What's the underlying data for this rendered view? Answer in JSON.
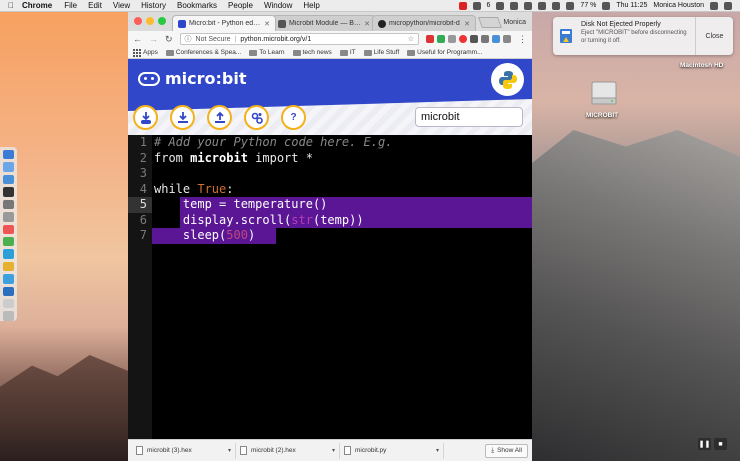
{
  "menubar": {
    "app": "Chrome",
    "items": [
      "File",
      "Edit",
      "View",
      "History",
      "Bookmarks",
      "People",
      "Window",
      "Help"
    ],
    "battery": "77 %",
    "clock": "Thu 11:25",
    "user": "Monica Houston",
    "badge_count": "6"
  },
  "tabs": [
    {
      "label": "Micro:bit - Python editor",
      "active": true,
      "favicon_color": "#2f47c8"
    },
    {
      "label": "Microbit Module — BBC m",
      "active": false,
      "favicon_color": "#555555"
    },
    {
      "label": "micropython/microbit-d",
      "active": false,
      "favicon_color": "#222222"
    }
  ],
  "profile": "Monica",
  "toolbar": {
    "security": "Not Secure",
    "url": "python.microbit.org/v/1"
  },
  "bookmarks": {
    "apps": "Apps",
    "items": [
      "Conferences & Spea...",
      "To Learn",
      "tech news",
      "IT",
      "Life Stuff",
      "Useful for Programm..."
    ]
  },
  "editor_app": {
    "logo_text": "micro:bit",
    "script_name": "microbit",
    "buttons": [
      {
        "name": "download-button",
        "icon": "download-icon"
      },
      {
        "name": "save-button",
        "icon": "save-icon"
      },
      {
        "name": "load-button",
        "icon": "load-icon"
      },
      {
        "name": "snippets-button",
        "icon": "snippets-icon"
      },
      {
        "name": "help-button",
        "icon": "help-icon"
      }
    ],
    "line_numbers": [
      "1",
      "2",
      "3",
      "4",
      "5",
      "6",
      "7"
    ],
    "current_line": "5",
    "code": {
      "l1": "# Add your Python code here. E.g.",
      "l2_a": "from ",
      "l2_b": "microbit",
      "l2_c": " import *",
      "l4_a": "while ",
      "l4_b": "True",
      "l4_c": ":",
      "l5": "    temp = temperature()",
      "l6_a": "    display.scroll(",
      "l6_b": "str",
      "l6_c": "(temp))",
      "l7_a": "    sleep(",
      "l7_b": "500",
      "l7_c": ")"
    },
    "colors": {
      "header": "#2f47c8",
      "button_ring": "#f3b21b",
      "selection": "#5a1694"
    }
  },
  "downloads": {
    "items": [
      "microbit (3).hex",
      "microbit (2).hex",
      "microbit.py"
    ],
    "show_all": "Show All"
  },
  "notification": {
    "title": "Disk Not Ejected Properly",
    "message": "Eject \"MICROBIT\" before disconnecting or turning it off.",
    "close": "Close"
  },
  "desktop": {
    "hd_label": "Macintosh HD",
    "drive_label": "MICROBIT"
  }
}
